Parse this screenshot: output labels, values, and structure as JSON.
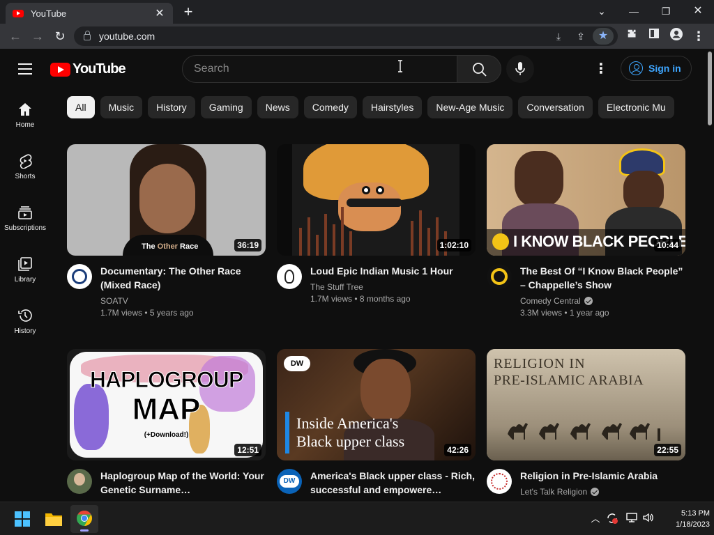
{
  "browser": {
    "tab_title": "YouTube",
    "url": "youtube.com"
  },
  "masthead": {
    "logo_text": "YouTube",
    "search_placeholder": "Search",
    "signin_label": "Sign in"
  },
  "sidebar": {
    "items": [
      {
        "label": "Home",
        "icon": "home-icon"
      },
      {
        "label": "Shorts",
        "icon": "shorts-icon"
      },
      {
        "label": "Subscriptions",
        "icon": "subscriptions-icon"
      },
      {
        "label": "Library",
        "icon": "library-icon"
      },
      {
        "label": "History",
        "icon": "history-icon"
      }
    ]
  },
  "chips": [
    "All",
    "Music",
    "History",
    "Gaming",
    "News",
    "Comedy",
    "Hairstyles",
    "New-Age Music",
    "Conversation",
    "Electronic Mu"
  ],
  "videos": [
    {
      "title": "Documentary: The Other Race (Mixed Race)",
      "channel": "SOATV",
      "stats": "1.7M views • 5 years ago",
      "duration": "36:19",
      "thumb_caption_a": "The ",
      "thumb_caption_b": "Other",
      "thumb_caption_c": " Race",
      "verified": false
    },
    {
      "title": "Loud Epic Indian Music 1 Hour",
      "channel": "The Stuff Tree",
      "stats": "1.7M views • 8 months ago",
      "duration": "1:02:10",
      "verified": false
    },
    {
      "title": "The Best Of “I Know Black People” – Chappelle’s Show",
      "channel": "Comedy Central",
      "stats": "3.3M views • 1 year ago",
      "duration": "10:44",
      "thumb_caption": "I KNOW BLACK PEOPLE",
      "verified": true
    },
    {
      "title": "Haplogroup Map of the World: Your Genetic Surname…",
      "channel": "",
      "stats": "",
      "duration": "12:51",
      "thumb_caption_a": "HAPLOGROUP",
      "thumb_caption_b": "MAP",
      "thumb_caption_c": "(+Download!)",
      "verified": false
    },
    {
      "title": "America's Black upper class - Rich, successful and empowere…",
      "channel": "",
      "stats": "",
      "duration": "42:26",
      "thumb_caption_a": "Inside America's",
      "thumb_caption_b": "Black upper class",
      "badge": "DW",
      "verified": false
    },
    {
      "title": "Religion in Pre-Islamic Arabia",
      "channel": "Let's Talk Religion",
      "stats": "",
      "duration": "22:55",
      "thumb_caption_a": "RELIGION IN",
      "thumb_caption_b": "PRE-ISLAMIC ARABIA",
      "verified": true
    }
  ],
  "taskbar": {
    "time": "5:13 PM",
    "date": "1/18/2023"
  },
  "colors": {
    "background": "#0f0f0f",
    "chip": "#272727",
    "chip_active": "#f1f1f1",
    "accent_blue": "#3ea6ff",
    "youtube_red": "#ff0000"
  }
}
